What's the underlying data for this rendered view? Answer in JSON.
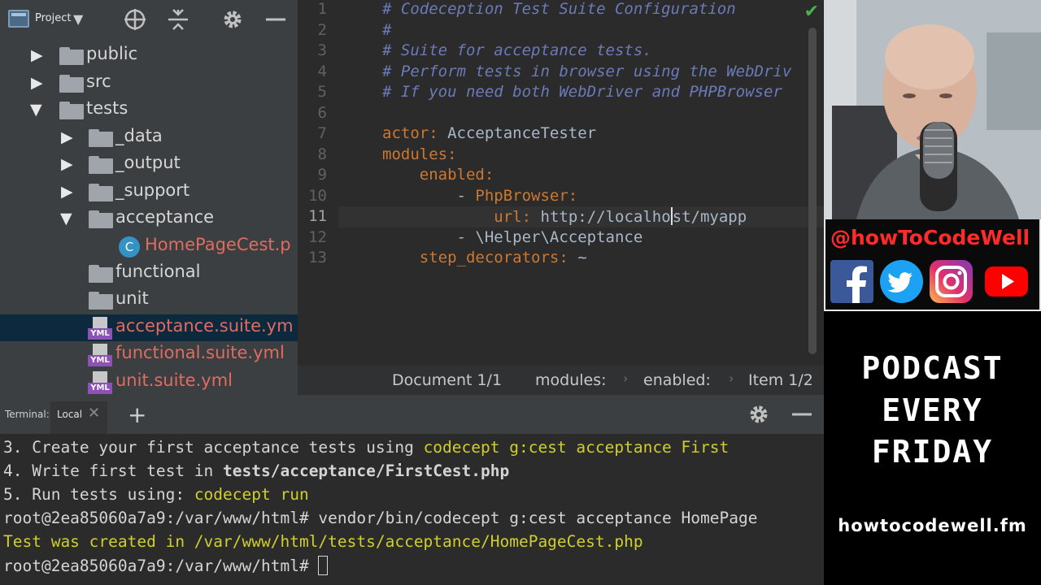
{
  "project_panel": {
    "title": "Project",
    "tree": [
      {
        "label": "public",
        "type": "folder",
        "state": "collapsed"
      },
      {
        "label": "src",
        "type": "folder",
        "state": "collapsed"
      },
      {
        "label": "tests",
        "type": "folder",
        "state": "expanded"
      },
      {
        "label": "_data",
        "type": "folder",
        "state": "collapsed"
      },
      {
        "label": "_output",
        "type": "folder",
        "state": "collapsed"
      },
      {
        "label": "_support",
        "type": "folder",
        "state": "collapsed"
      },
      {
        "label": "acceptance",
        "type": "folder",
        "state": "expanded"
      },
      {
        "label": "HomePageCest.p",
        "type": "php-class"
      },
      {
        "label": "functional",
        "type": "folder"
      },
      {
        "label": "unit",
        "type": "folder"
      },
      {
        "label": "acceptance.suite.ym",
        "type": "yml",
        "selected": true
      },
      {
        "label": "functional.suite.yml",
        "type": "yml"
      },
      {
        "label": "unit.suite.yml",
        "type": "yml"
      }
    ],
    "yml_badge": "YML",
    "class_badge": "C"
  },
  "editor": {
    "line_numbers": [
      "1",
      "2",
      "3",
      "4",
      "5",
      "6",
      "7",
      "8",
      "9",
      "10",
      "11",
      "12",
      "13"
    ],
    "lines": [
      {
        "comment": "# Codeception Test Suite Configuration"
      },
      {
        "comment": "#"
      },
      {
        "comment": "# Suite for acceptance tests."
      },
      {
        "comment": "# Perform tests in browser using the WebDriv"
      },
      {
        "comment": "# If you need both WebDriver and PHPBrowser"
      },
      {},
      {
        "key": "actor",
        "sep": ": ",
        "value": "AcceptanceTester"
      },
      {
        "key": "modules",
        "sep": ":"
      },
      {
        "indent": "    ",
        "key": "enabled",
        "sep": ":"
      },
      {
        "indent": "        ",
        "dash": "- ",
        "key": "PhpBrowser",
        "sep": ":"
      },
      {
        "indent": "            ",
        "key": "url",
        "sep": ": ",
        "value_before_caret": "http://localho",
        "value_after_caret": "st/myapp"
      },
      {
        "indent": "        ",
        "dash": "- ",
        "value": "\\Helper\\Acceptance"
      },
      {
        "indent": "    ",
        "key": "step_decorators",
        "sep": ": ",
        "value": "~"
      }
    ],
    "breadcrumb": [
      "Document 1/1",
      "modules:",
      "enabled:",
      "Item 1/2"
    ]
  },
  "terminal": {
    "title": "Terminal:",
    "tab_label": "Local",
    "lines": [
      {
        "text": "3. Create your first acceptance tests using ",
        "highlight": "codecept g:cest acceptance First"
      },
      {
        "text": "4. Write first test in ",
        "bold": "tests/acceptance/FirstCest.php"
      },
      {
        "text": "5. Run tests using: ",
        "highlight": "codecept run"
      },
      {
        "text": "root@2ea85060a7a9:/var/www/html# vendor/bin/codecept g:cest acceptance HomePage"
      },
      {
        "highlight": "Test was created in /var/www/html/tests/acceptance/HomePageCest.php"
      },
      {
        "text": "root@2ea85060a7a9:/var/www/html# "
      }
    ]
  },
  "overlay": {
    "handle": "@howToCodeWell",
    "socials": [
      "facebook-icon",
      "twitter-icon",
      "instagram-icon",
      "youtube-icon"
    ],
    "podcast_lines": [
      "PODCAST",
      "EVERY",
      "FRIDAY"
    ],
    "podcast_url": "howtocodewell.fm"
  },
  "colors": {
    "comment": "#6b7ab8",
    "yaml_key": "#cc7832",
    "terminal_highlight": "#cfcf2c",
    "handle": "#ff2a2a",
    "modified_file": "#e06c60"
  }
}
